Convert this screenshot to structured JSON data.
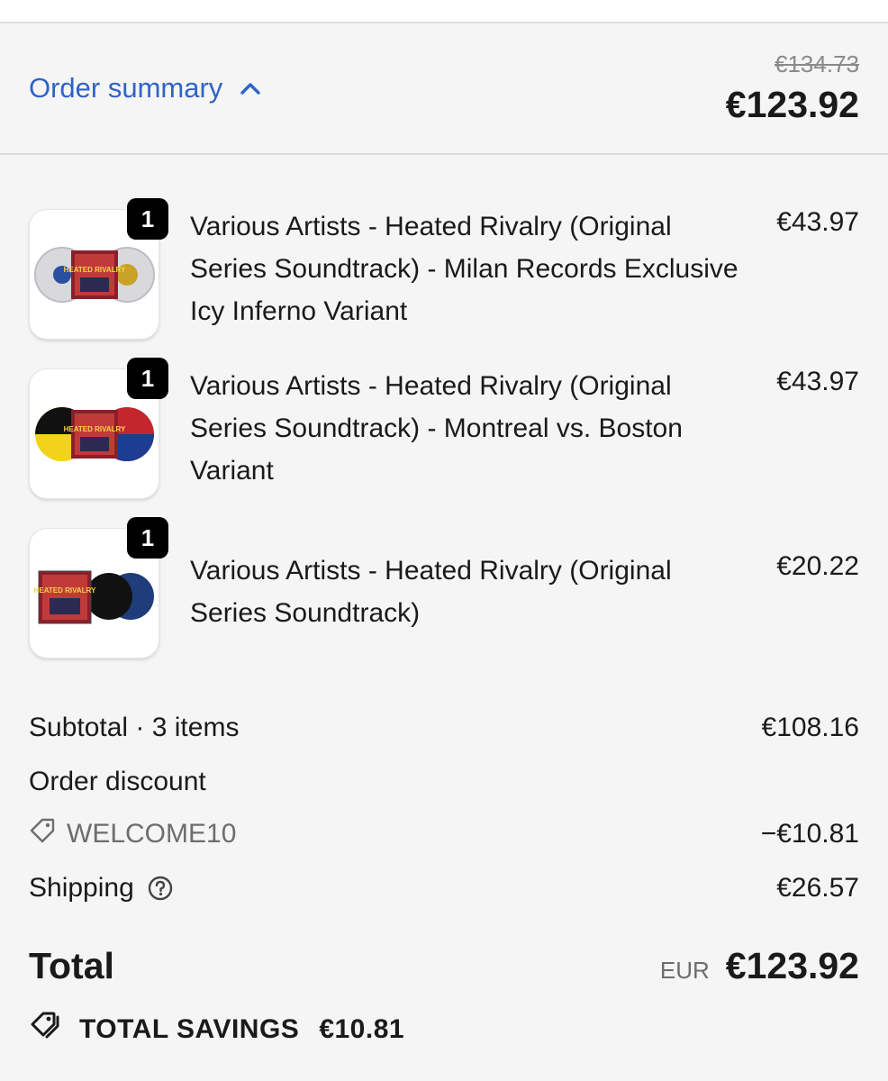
{
  "header": {
    "toggle_label": "Order summary",
    "original_price": "€134.73",
    "total": "€123.92"
  },
  "items": [
    {
      "quantity": "1",
      "title": "Various Artists - Heated Rivalry (Original Series Soundtrack) - Milan Records Exclusive Icy Inferno Variant",
      "price": "€43.97",
      "thumb_art_text": "HEATED RIVALRY"
    },
    {
      "quantity": "1",
      "title": "Various Artists - Heated Rivalry (Original Series Soundtrack) - Montreal vs. Boston Variant",
      "price": "€43.97",
      "thumb_art_text": "HEATED RIVALRY"
    },
    {
      "quantity": "1",
      "title": "Various Artists - Heated Rivalry (Original Series Soundtrack)",
      "price": "€20.22",
      "thumb_art_text": "HEATED RIVALRY"
    }
  ],
  "totals": {
    "subtotal_label": "Subtotal · 3 items",
    "subtotal_value": "€108.16",
    "discount_label": "Order discount",
    "discount_code": "WELCOME10",
    "discount_value": "−€10.81",
    "shipping_label": "Shipping",
    "shipping_value": "€26.57",
    "total_label": "Total",
    "currency": "EUR",
    "total_value": "€123.92",
    "savings_label": "TOTAL SAVINGS",
    "savings_value": "€10.81"
  },
  "colors": {
    "link_blue": "#2f63c8",
    "background": "#f5f5f5",
    "badge": "#000000"
  },
  "icons": [
    "chevron-up-icon",
    "tag-icon",
    "help-circle-icon",
    "savings-tag-icon"
  ]
}
